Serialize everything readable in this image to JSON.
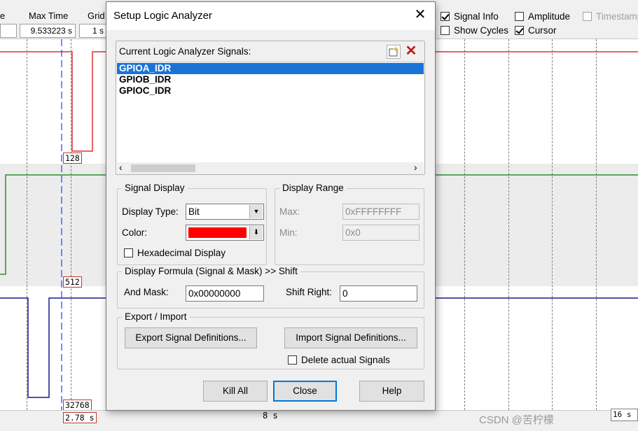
{
  "header": {
    "col_partial_label": "e",
    "max_time_label": "Max Time",
    "max_time_value": "9.533223 s",
    "grid_label": "Grid",
    "grid_value": "1 s",
    "options": [
      {
        "label": "Signal Info",
        "checked": true,
        "enabled": true
      },
      {
        "label": "Amplitude",
        "checked": false,
        "enabled": true
      },
      {
        "label": "Timestamp",
        "checked": false,
        "enabled": false
      },
      {
        "label": "Show Cycles",
        "checked": false,
        "enabled": true
      },
      {
        "label": "Cursor",
        "checked": true,
        "enabled": true
      }
    ]
  },
  "waveforms": {
    "tags": [
      "128",
      "512",
      "32768",
      "2.78 s"
    ],
    "colors": {
      "gpioa": "#e03030",
      "gpiob": "#2e8b2e",
      "gpioc": "#1a1a8c",
      "cursor": "#1f3fff"
    }
  },
  "footer": {
    "time_label": "8 s",
    "right_value": "16 s",
    "watermark": "CSDN @苦柠檬"
  },
  "dialog": {
    "title": "Setup Logic Analyzer",
    "signals_header": "Current Logic Analyzer Signals:",
    "signals": [
      "GPIOA_IDR",
      "GPIOB_IDR",
      "GPIOC_IDR"
    ],
    "selected_index": 0,
    "signal_display": {
      "title": "Signal Display",
      "display_type_label": "Display Type:",
      "display_type_value": "Bit",
      "color_label": "Color:",
      "color_value": "#ff0000",
      "hex_label": "Hexadecimal Display"
    },
    "display_range": {
      "title": "Display Range",
      "max_label": "Max:",
      "max_value": "0xFFFFFFFF",
      "min_label": "Min:",
      "min_value": "0x0"
    },
    "formula": {
      "title": "Display Formula (Signal & Mask) >> Shift",
      "and_mask_label": "And Mask:",
      "and_mask_value": "0x00000000",
      "shift_label": "Shift Right:",
      "shift_value": "0"
    },
    "export_import": {
      "title": "Export / Import",
      "export_btn": "Export Signal Definitions...",
      "import_btn": "Import Signal Definitions...",
      "delete_label": "Delete actual Signals"
    },
    "buttons": {
      "kill_all": "Kill All",
      "close": "Close",
      "help": "Help"
    }
  }
}
